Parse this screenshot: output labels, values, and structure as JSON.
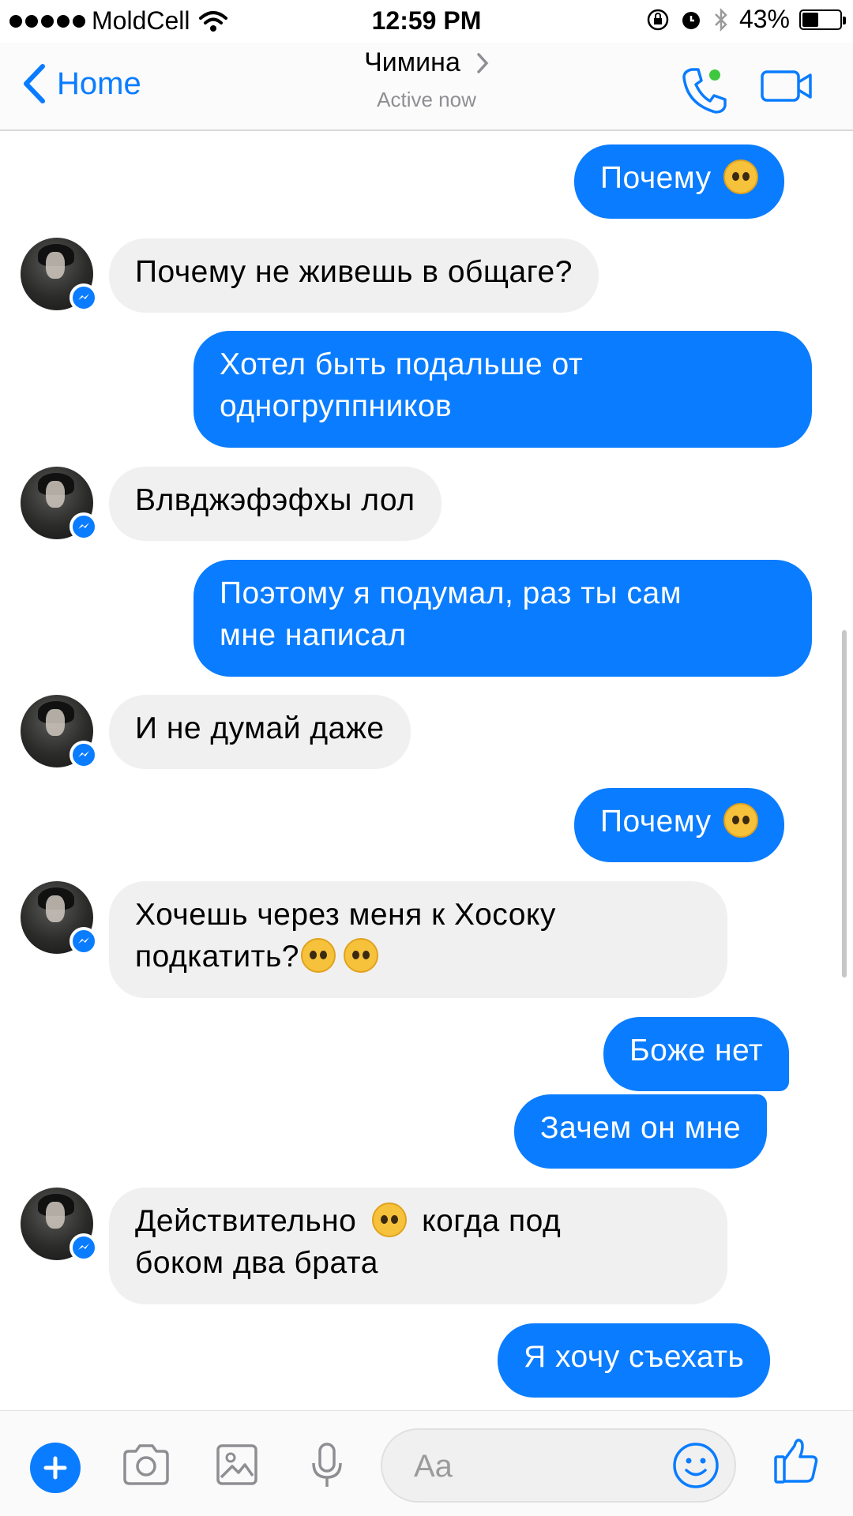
{
  "status_bar": {
    "carrier": "MoldCell",
    "time": "12:59 PM",
    "battery": "43%",
    "battery_level": 0.43
  },
  "nav": {
    "back_label": "Home",
    "contact_name": "Чимина",
    "status": "Active now"
  },
  "messages": [
    {
      "dir": "out",
      "text": "Почему",
      "emoji": "pleading-face"
    },
    {
      "dir": "in",
      "text": "Почему не живешь в общаге?"
    },
    {
      "dir": "out",
      "line1": "Хотел быть подальше от",
      "line2": "одногруппников"
    },
    {
      "dir": "in",
      "text": "Влвджэфэфхы лол"
    },
    {
      "dir": "out",
      "line1": "Поэтому я подумал, раз ты сам",
      "line2": "мне написал"
    },
    {
      "dir": "in",
      "text": "И не думай даже"
    },
    {
      "dir": "out",
      "text": "Почему",
      "emoji": "pleading-face"
    },
    {
      "dir": "in",
      "line1": "Хочешь через меня к Хосоку",
      "line2": "подкатить?",
      "emoji": "raised-eyebrow-face x2"
    },
    {
      "dir": "out",
      "text": "Боже нет"
    },
    {
      "dir": "out",
      "text": "Зачем он мне"
    },
    {
      "dir": "in",
      "line1a": "Действительно",
      "line1b": "когда под",
      "line2": "боком два брата",
      "emoji": "smirking-face"
    },
    {
      "dir": "out",
      "text": "Я хочу съехать"
    }
  ],
  "composer": {
    "placeholder": "Aa"
  },
  "colors": {
    "accent": "#0a7cff",
    "incoming_bubble": "#f1f0f0",
    "online": "#3fc83f"
  },
  "icons": [
    "back-chevron-icon",
    "phone-icon",
    "video-camera-icon",
    "plus-icon",
    "camera-icon",
    "image-icon",
    "microphone-icon",
    "smiley-icon",
    "thumbs-up-icon",
    "messenger-badge-icon",
    "wifi-icon",
    "alarm-icon",
    "bluetooth-icon",
    "rotation-lock-icon"
  ]
}
